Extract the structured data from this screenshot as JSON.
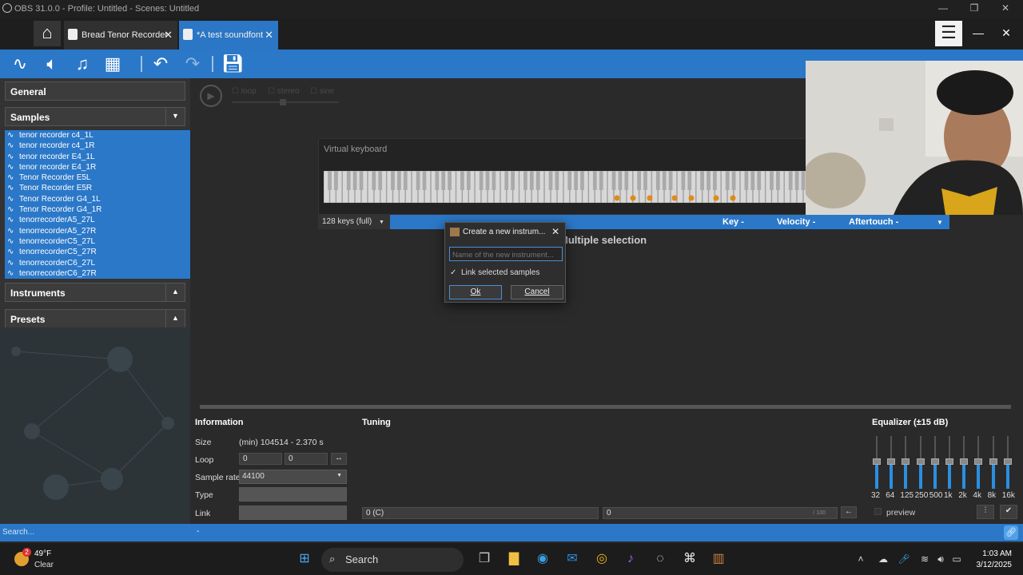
{
  "titlebar": {
    "title": "OBS 31.0.0 - Profile: Untitled - Scenes: Untitled",
    "minimize": "—",
    "maximize": "❐",
    "close": "✕"
  },
  "tabs": [
    {
      "label": "Bread Tenor Recorder",
      "close": "✕"
    },
    {
      "label": "*A test soundfont",
      "close": "✕"
    }
  ],
  "window_controls": {
    "minimize": "—",
    "close": "✕"
  },
  "toolbar": {
    "icons": [
      "waveform-icon",
      "speaker-icon",
      "music-note-icon",
      "toolbox-icon",
      "undo-icon",
      "redo-icon",
      "save-icon"
    ]
  },
  "sidebar": {
    "general": "General",
    "samples": "Samples",
    "samples_arrow": "▼",
    "instruments": "Instruments",
    "presets": "Presets",
    "collapse_arrow": "▲",
    "sample_items": [
      "tenor recorder c4_1L",
      "tenor recorder c4_1R",
      "tenor recorder E4_1L",
      "tenor recorder E4_1R",
      "Tenor Recorder E5L",
      "Tenor Recorder E5R",
      "Tenor Recorder G4_1L",
      "Tenor Recorder G4_1R",
      "tenorrecorderA5_27L",
      "tenorrecorderA5_27R",
      "tenorrecorderC5_27L",
      "tenorrecorderC5_27R",
      "tenorrecorderC6_27L",
      "tenorrecorderC6_27R"
    ]
  },
  "player": {
    "loop": "loop",
    "stereo": "stereo",
    "sine": "sine"
  },
  "virtual_keyboard": {
    "title": "Virtual keyboard",
    "range": "128 keys (full)",
    "key_label": "Key",
    "velocity_label": "Velocity",
    "aftertouch_label": "Aftertouch",
    "dash": "-",
    "dropdown": "▼",
    "marked_keys": 8
  },
  "multiple_selection": "Multiple selection",
  "dialog": {
    "title": "Create a new instrum...",
    "close": "✕",
    "placeholder": "Name of the new instrument...",
    "checkbox_label": "Link selected samples",
    "checked": "✓",
    "ok": "Ok",
    "cancel": "Cancel"
  },
  "information": {
    "heading": "Information",
    "size_label": "Size",
    "size_value": "(min) 104514 - 2.370 s",
    "loop_label": "Loop",
    "loop_start": "0",
    "loop_end": "0",
    "sample_rate_label": "Sample rate",
    "sample_rate_value": "44100",
    "type_label": "Type",
    "link_label": "Link"
  },
  "tuning": {
    "heading": "Tuning",
    "pitch": "0 (C)",
    "correction": "0",
    "correction_unit": "/ 100"
  },
  "equalizer": {
    "heading": "Equalizer (±15 dB)",
    "bands": [
      "32",
      "64",
      "125",
      "250",
      "500",
      "1k",
      "2k",
      "4k",
      "8k",
      "16k"
    ],
    "preview": "preview"
  },
  "statusbar": {
    "search_placeholder": "Search...",
    "dash": "-"
  },
  "taskbar": {
    "weather_temp": "49°F",
    "weather_desc": "Clear",
    "weather_badge": "2",
    "search": "Search",
    "time": "1:03 AM",
    "date": "3/12/2025"
  },
  "colors": {
    "accent": "#2b78c8",
    "panel": "#333333",
    "background": "#2a2a2a",
    "key_marker": "#e08a1a"
  }
}
